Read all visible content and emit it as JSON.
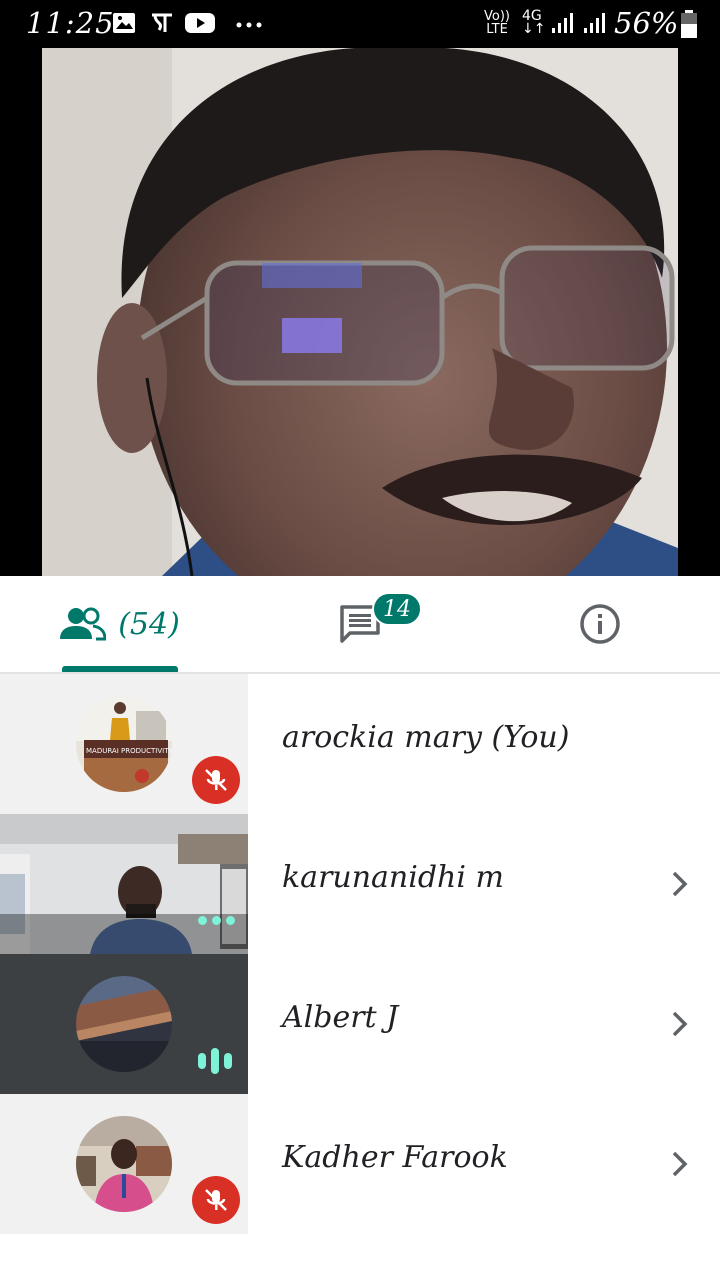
{
  "status_bar": {
    "time": "11:25",
    "network_label_top": "Vo))",
    "network_label_bottom": "LTE",
    "network_type": "4G",
    "battery": "56%",
    "icons": [
      "image-icon",
      "notification-pe-icon",
      "youtube-icon",
      "more-dots-icon",
      "signal-icon",
      "battery-icon"
    ]
  },
  "tabs": {
    "people_count": "(54)",
    "chat_badge": "14",
    "icons": [
      "people-icon",
      "chat-icon",
      "info-icon"
    ]
  },
  "participants": [
    {
      "name": "arockia mary (You)",
      "status": "muted",
      "avatar_sign_text": "MADURAI PRODUCTIVITY COU"
    },
    {
      "name": "karunanidhi m",
      "status": "connecting"
    },
    {
      "name": "Albert J",
      "status": "speaking"
    },
    {
      "name": "Kadher Farook",
      "status": "muted"
    }
  ],
  "colors": {
    "accent": "#00796b",
    "muted_red": "#d93025",
    "speaking_teal": "#7ff3d8"
  }
}
